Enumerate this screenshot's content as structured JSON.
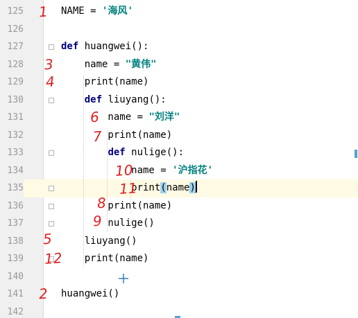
{
  "editor": {
    "lines": [
      {
        "num": "125",
        "segs": [
          {
            "t": "NAME = ",
            "c": "n"
          },
          {
            "t": "'海风'",
            "c": "s"
          }
        ]
      },
      {
        "num": "126",
        "segs": []
      },
      {
        "num": "127",
        "segs": [
          {
            "t": "def",
            "c": "k"
          },
          {
            "t": " huangwei():",
            "c": "n"
          }
        ]
      },
      {
        "num": "128",
        "segs": [
          {
            "t": "    name = ",
            "c": "n"
          },
          {
            "t": "\"黄伟\"",
            "c": "s"
          }
        ]
      },
      {
        "num": "129",
        "segs": [
          {
            "t": "    print(name)",
            "c": "n"
          }
        ]
      },
      {
        "num": "130",
        "segs": [
          {
            "t": "    ",
            "c": "n"
          },
          {
            "t": "def",
            "c": "k"
          },
          {
            "t": " liuyang():",
            "c": "n"
          }
        ]
      },
      {
        "num": "131",
        "segs": [
          {
            "t": "        name = ",
            "c": "n"
          },
          {
            "t": "\"刘洋\"",
            "c": "s"
          }
        ]
      },
      {
        "num": "132",
        "segs": [
          {
            "t": "        print(name)",
            "c": "n"
          }
        ]
      },
      {
        "num": "133",
        "segs": [
          {
            "t": "        ",
            "c": "n"
          },
          {
            "t": "def",
            "c": "k"
          },
          {
            "t": " nulige():",
            "c": "n"
          }
        ]
      },
      {
        "num": "134",
        "segs": [
          {
            "t": "            name = ",
            "c": "n"
          },
          {
            "t": "'沪指花'",
            "c": "s"
          }
        ]
      },
      {
        "num": "135",
        "segs": [
          {
            "t": "            print",
            "c": "n"
          },
          {
            "t": "(",
            "c": "m"
          },
          {
            "t": "name",
            "c": "n"
          },
          {
            "t": ")",
            "c": "m"
          },
          {
            "t": "",
            "c": "caret"
          }
        ]
      },
      {
        "num": "136",
        "segs": [
          {
            "t": "        print(name)",
            "c": "n"
          }
        ]
      },
      {
        "num": "137",
        "segs": [
          {
            "t": "        nulige()",
            "c": "n"
          }
        ]
      },
      {
        "num": "138",
        "segs": [
          {
            "t": "    liuyang()",
            "c": "n"
          }
        ]
      },
      {
        "num": "139",
        "segs": [
          {
            "t": "    print(name)",
            "c": "n"
          }
        ]
      },
      {
        "num": "140",
        "segs": []
      },
      {
        "num": "141",
        "segs": [
          {
            "t": "huangwei()",
            "c": "n"
          }
        ]
      },
      {
        "num": "142",
        "segs": []
      }
    ],
    "current_line": "135",
    "fold_markers": [
      "127",
      "130",
      "133",
      "135",
      "136",
      "137",
      "139"
    ]
  },
  "annotations": [
    {
      "line": "125",
      "text": "1"
    },
    {
      "line": "128",
      "text": "3"
    },
    {
      "line": "129",
      "text": "4"
    },
    {
      "line": "131",
      "text": "6"
    },
    {
      "line": "132",
      "text": "7"
    },
    {
      "line": "134",
      "text": "10"
    },
    {
      "line": "135",
      "text": "11"
    },
    {
      "line": "136",
      "text": "8"
    },
    {
      "line": "137",
      "text": "9"
    },
    {
      "line": "138",
      "text": "5"
    },
    {
      "line": "139",
      "text": "12"
    },
    {
      "line": "141",
      "text": "2"
    }
  ],
  "colors": {
    "keyword": "#000080",
    "string": "#008080",
    "annotation": "#e02020",
    "current_line": "#fffae3",
    "brace_match": "#9ed2ee"
  },
  "icons": [
    "fold-marker-icon",
    "crosshair-cursor-icon"
  ]
}
